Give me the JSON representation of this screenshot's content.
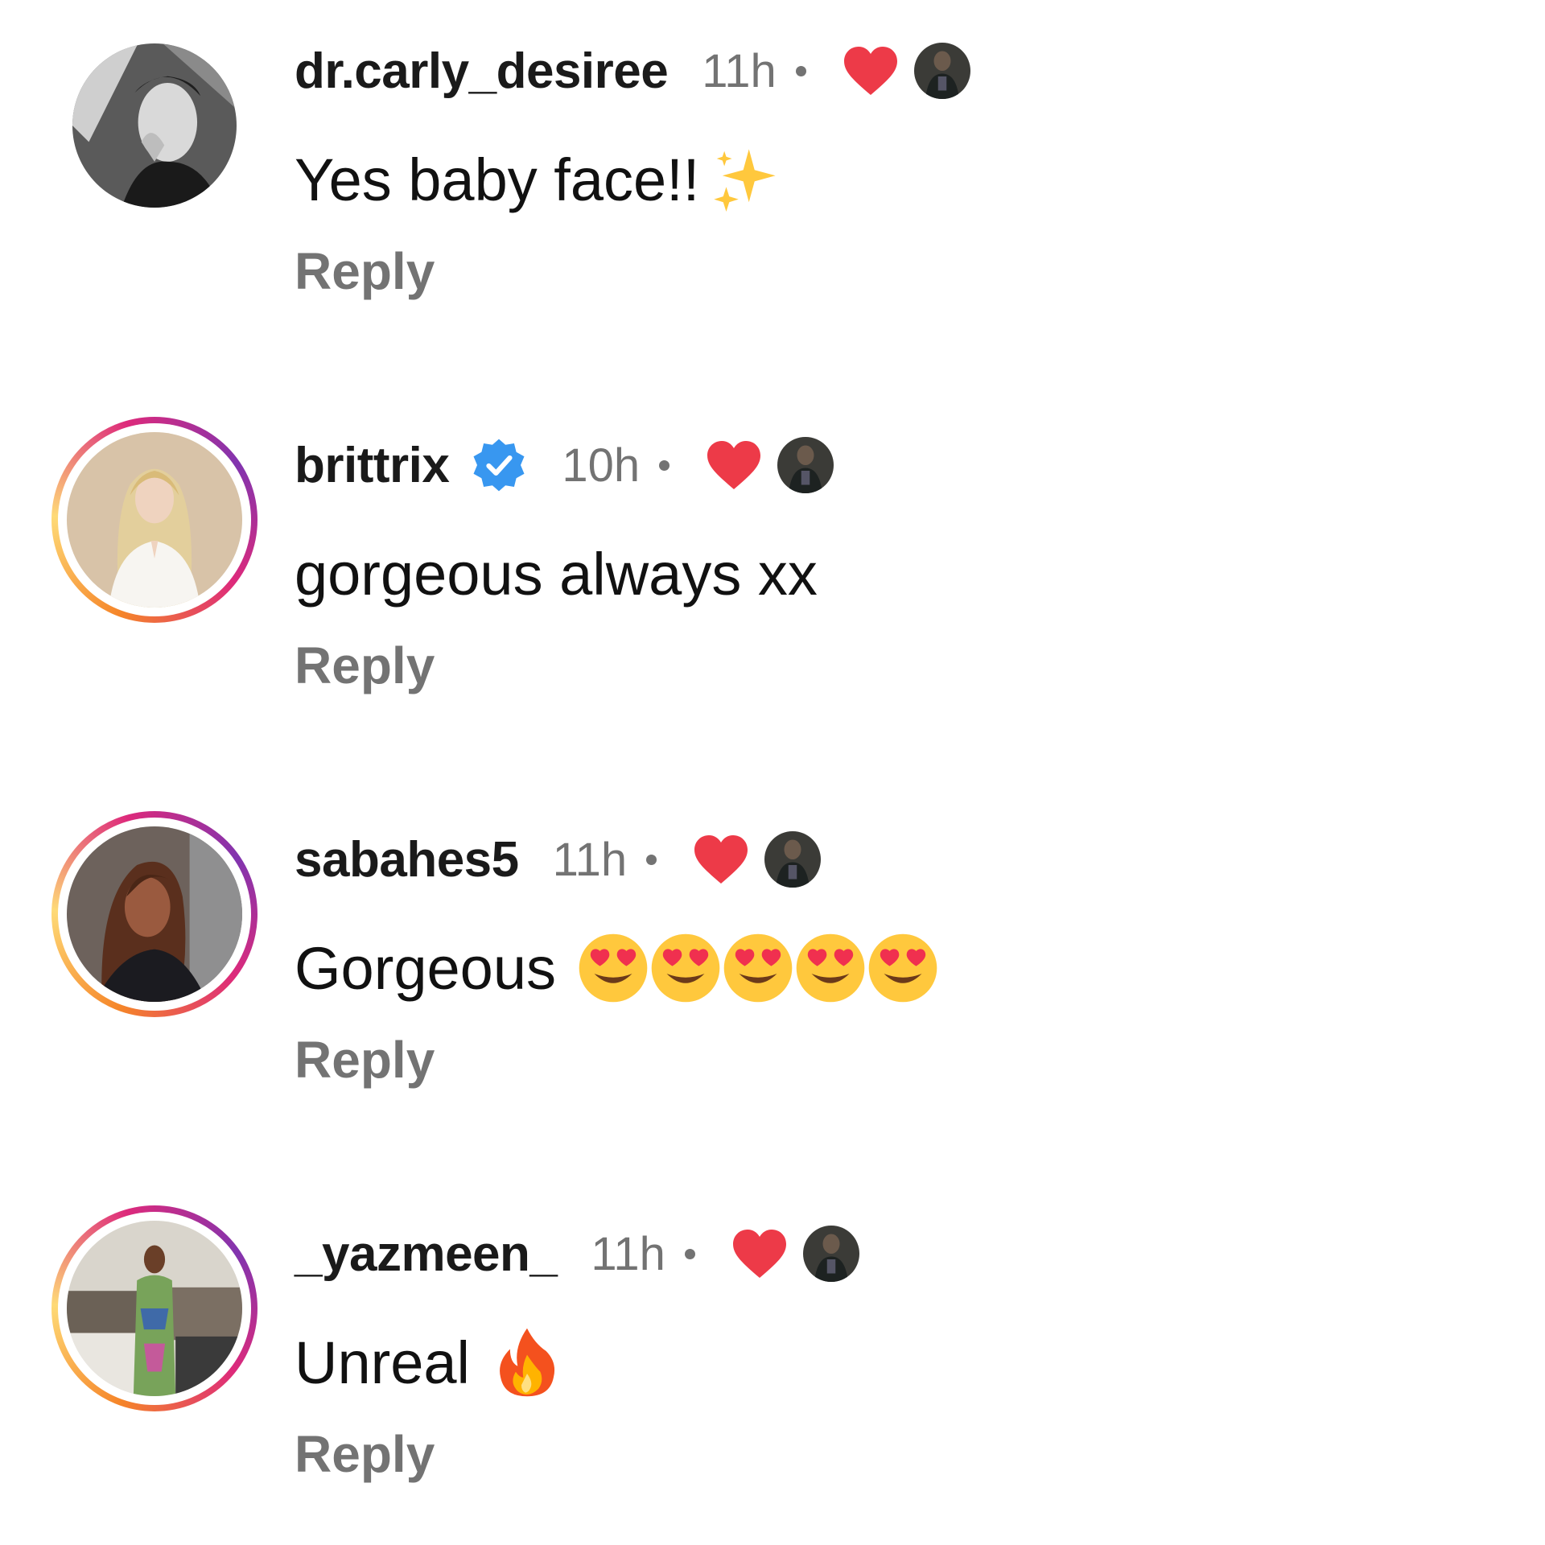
{
  "comments": [
    {
      "username": "dr.carly_desiree",
      "time": "11h",
      "text": "Yes baby face!!",
      "emoji": "sparkles",
      "reply": "Reply",
      "verified": false,
      "story_ring": false
    },
    {
      "username": "brittrix",
      "time": "10h",
      "text": "gorgeous always xx",
      "reply": "Reply",
      "verified": true,
      "story_ring": true
    },
    {
      "username": "sabahes5",
      "time": "11h",
      "text": "Gorgeous",
      "emoji": "heart-eyes x5",
      "reply": "Reply",
      "verified": false,
      "story_ring": true
    },
    {
      "username": "_yazmeen_",
      "time": "11h",
      "text": "Unreal",
      "emoji": "fire",
      "reply": "Reply",
      "verified": false,
      "story_ring": true
    }
  ],
  "colors": {
    "like_heart": "#ED3A48",
    "verified_badge": "#3897F0",
    "muted_text": "#737373"
  }
}
